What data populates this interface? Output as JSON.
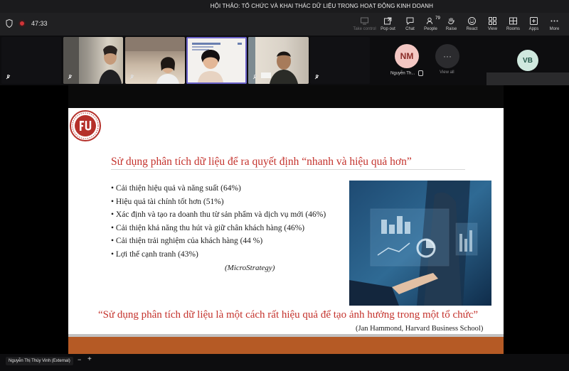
{
  "meeting": {
    "title": "HỘI THẢO: TỔ CHỨC VÀ KHAI THÁC DỮ LIỆU TRONG HOẠT ĐỘNG KINH DOANH",
    "timer": "47:33"
  },
  "toolbar": {
    "take_control": "Take control",
    "pop_out": "Pop out",
    "chat": "Chat",
    "people": "People",
    "people_count": "79",
    "raise": "Raise",
    "react": "React",
    "view": "View",
    "rooms": "Rooms",
    "apps": "Apps",
    "more": "More"
  },
  "participants": {
    "nm_initials": "NM",
    "nm_name": "Nguyễn Th...",
    "view_all": "View all",
    "vb_initials": "VB"
  },
  "slide": {
    "title": "Sử dụng phân tích dữ liệu để ra quyết định “nhanh và hiệu quả hơn”",
    "bullets": [
      "Cải thiện hiệu quả và năng suất (64%)",
      "Hiệu quả tài chính tốt hơn (51%)",
      "Xác định và tạo ra doanh thu từ sản phẩm và dịch vụ mới (46%)",
      "Cải thiện khả năng thu hút và giữ chân khách hàng (46%)",
      "Cải thiện trải nghiệm của khách hàng (44 %)",
      "Lợi thế cạnh tranh (43%)"
    ],
    "source": "(MicroStrategy)",
    "quote": "“Sử dụng phân tích dữ liệu là một cách rất hiệu quả để tạo ảnh hưởng trong một tổ chức”",
    "attribution": "(Jan Hammond, Harvard Business School)"
  },
  "presenter": {
    "name": "Nguyễn Thị Thúy Vinh (External)",
    "zoom_out": "−",
    "zoom_in": "+"
  }
}
